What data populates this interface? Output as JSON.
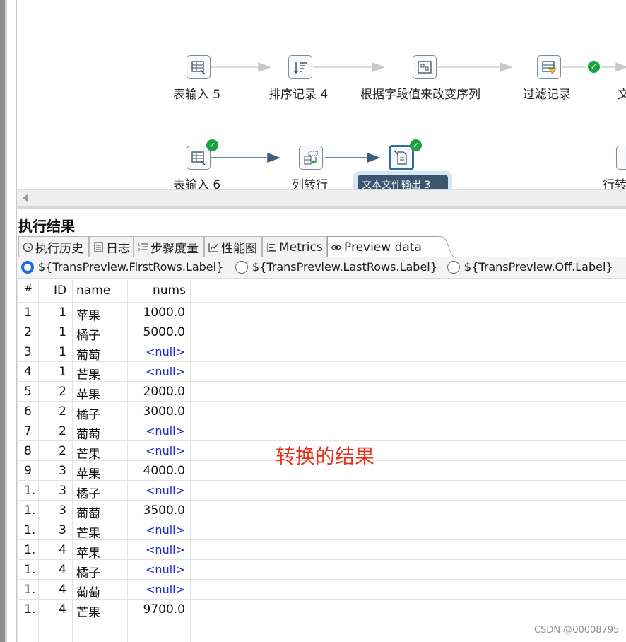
{
  "canvas": {
    "steps": [
      {
        "label": "表输入 5",
        "icon": "table-input-icon"
      },
      {
        "label": "排序记录 4",
        "icon": "sort-icon"
      },
      {
        "label": "根据字段值来改变序列",
        "icon": "sequence-icon"
      },
      {
        "label": "过滤记录",
        "icon": "filter-icon"
      },
      {
        "label": "文",
        "icon": "text-icon"
      },
      {
        "label": "表输入 6",
        "icon": "table-input-icon"
      },
      {
        "label": "列转行",
        "icon": "pivot-icon"
      },
      {
        "label": "行转",
        "icon": "unpivot-icon"
      }
    ],
    "tooltip": "文本文件输出 3"
  },
  "results": {
    "title": "执行结果",
    "tabs": [
      "执行历史",
      "日志",
      "步骤度量",
      "性能图",
      "Metrics",
      "Preview data"
    ],
    "active_tab": "Preview data",
    "radios": [
      "${TransPreview.FirstRows.Label}",
      "${TransPreview.LastRows.Label}",
      "${TransPreview.Off.Label}"
    ],
    "selected_radio": "${TransPreview.FirstRows.Label}"
  },
  "table": {
    "columns": [
      "#",
      "ID",
      "name",
      "nums"
    ],
    "rows": [
      [
        "1",
        "1",
        "苹果",
        "1000.0"
      ],
      [
        "2",
        "1",
        "橘子",
        "5000.0"
      ],
      [
        "3",
        "1",
        "葡萄",
        "<null>"
      ],
      [
        "4",
        "1",
        "芒果",
        "<null>"
      ],
      [
        "5",
        "2",
        "苹果",
        "2000.0"
      ],
      [
        "6",
        "2",
        "橘子",
        "3000.0"
      ],
      [
        "7",
        "2",
        "葡萄",
        "<null>"
      ],
      [
        "8",
        "2",
        "芒果",
        "<null>"
      ],
      [
        "9",
        "3",
        "苹果",
        "4000.0"
      ],
      [
        "1.",
        "3",
        "橘子",
        "<null>"
      ],
      [
        "1.",
        "3",
        "葡萄",
        "3500.0"
      ],
      [
        "1.",
        "3",
        "芒果",
        "<null>"
      ],
      [
        "1.",
        "4",
        "苹果",
        "<null>"
      ],
      [
        "1.",
        "4",
        "橘子",
        "<null>"
      ],
      [
        "1.",
        "4",
        "葡萄",
        "<null>"
      ],
      [
        "1.",
        "4",
        "芒果",
        "9700.0"
      ]
    ]
  },
  "annotation": "转换的结果",
  "watermark": "CSDN @00008795",
  "colors": {
    "accent": "#1f6fd6",
    "null_text": "#1d2bd4",
    "annotation": "#e5321d",
    "check": "#19a33c"
  }
}
